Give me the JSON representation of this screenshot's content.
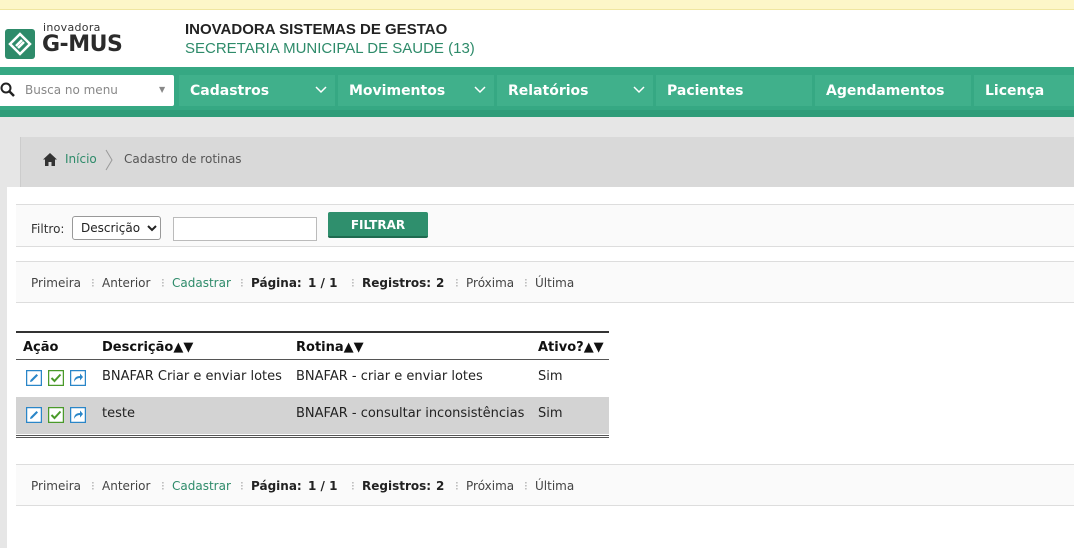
{
  "header": {
    "logo_small": "inovadora",
    "logo_big": "G-MUS",
    "system_title": "INOVADORA SISTEMAS DE GESTAO",
    "subtitle": "SECRETARIA MUNICIPAL DE SAUDE (13)"
  },
  "navbar": {
    "search_placeholder": "Busca no menu",
    "items": [
      {
        "label": "Cadastros",
        "has_dropdown": true
      },
      {
        "label": "Movimentos",
        "has_dropdown": true
      },
      {
        "label": "Relatórios",
        "has_dropdown": true
      },
      {
        "label": "Pacientes",
        "has_dropdown": false
      },
      {
        "label": "Agendamentos",
        "has_dropdown": false
      },
      {
        "label": "Licença",
        "has_dropdown": false
      }
    ]
  },
  "breadcrumb": {
    "home": "Início",
    "current": "Cadastro de rotinas"
  },
  "filter": {
    "label": "Filtro:",
    "selected_option": "Descrição",
    "input_value": "",
    "button_label": "FILTRAR"
  },
  "pager": {
    "first": "Primeira",
    "previous": "Anterior",
    "register": "Cadastrar",
    "page_label": "Página:",
    "page_value": "1 / 1",
    "records_label": "Registros:",
    "records_value": "2",
    "next": "Próxima",
    "last": "Última"
  },
  "table": {
    "columns": {
      "action": "Ação",
      "description": "Descrição",
      "routine": "Rotina",
      "active": "Ativo?"
    },
    "sort_glyph": "▲▼",
    "rows": [
      {
        "description": "BNAFAR Criar e enviar lotes",
        "routine": "BNAFAR - criar e enviar lotes",
        "active": "Sim"
      },
      {
        "description": "teste",
        "routine": "BNAFAR - consultar inconsistências",
        "active": "Sim"
      }
    ]
  },
  "colors": {
    "brand_green": "#36a883",
    "button_green": "#2f8f6d",
    "link_green": "#2e8b6a"
  }
}
